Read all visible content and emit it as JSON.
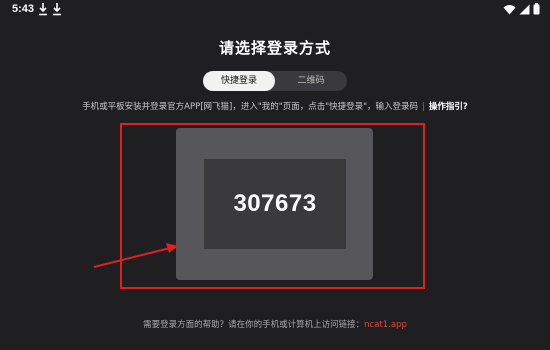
{
  "status_bar": {
    "time": "5:43",
    "icons": [
      "download-icon",
      "download-icon",
      "wifi-icon",
      "cellular-signal-icon",
      "battery-icon"
    ]
  },
  "page": {
    "title": "请选择登录方式",
    "tabs": [
      {
        "label": "快捷登录",
        "active": true
      },
      {
        "label": "二维码",
        "active": false
      }
    ],
    "hint": {
      "text": "手机或平板安装并登录官方APP[网飞猫]，进入\"我的\"页面，点击\"快捷登录\"，输入登录码",
      "separator": "|",
      "guide_link": "操作指引?"
    },
    "login_code": "307673",
    "footer": {
      "text": "需要登录方面的帮助？请在你的手机或计算机上访问链接：",
      "link": "ncat1.app"
    }
  },
  "colors": {
    "background": "#1f1f22",
    "annotation_red": "#e02020",
    "link_red": "#e5483f"
  }
}
